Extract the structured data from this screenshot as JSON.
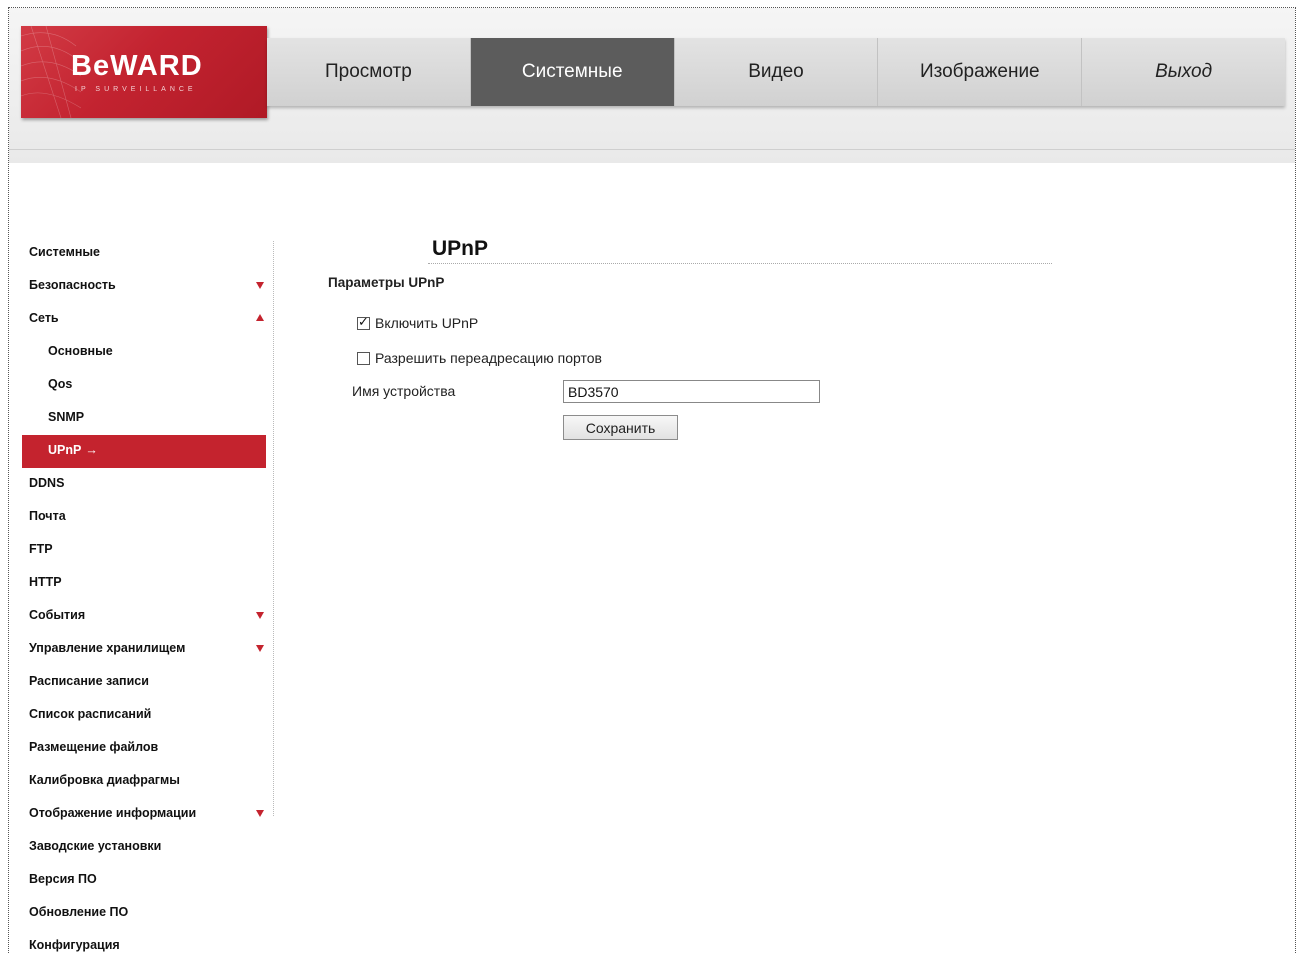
{
  "logo": {
    "brand": "BeWARD",
    "tagline": "IP SURVEILLANCE"
  },
  "nav": {
    "items": [
      {
        "label": "Просмотр"
      },
      {
        "label": "Системные"
      },
      {
        "label": "Видео"
      },
      {
        "label": "Изображение"
      },
      {
        "label": "Выход"
      }
    ],
    "active": "Системные"
  },
  "sidebar": {
    "items": [
      {
        "label": "Системные"
      },
      {
        "label": "Безопасность",
        "icon": "expand-down"
      },
      {
        "label": "Сеть",
        "icon": "collapse-up"
      },
      {
        "label": "Основные"
      },
      {
        "label": "Qos"
      },
      {
        "label": "SNMP"
      },
      {
        "label": "UPnP",
        "active_marker": "→"
      },
      {
        "label": "DDNS"
      },
      {
        "label": "Почта"
      },
      {
        "label": "FTP"
      },
      {
        "label": "HTTP"
      },
      {
        "label": "События",
        "icon": "expand-down"
      },
      {
        "label": "Управление хранилищем",
        "icon": "expand-down"
      },
      {
        "label": "Расписание записи"
      },
      {
        "label": "Список расписаний"
      },
      {
        "label": "Размещение файлов"
      },
      {
        "label": "Калибровка диафрагмы"
      },
      {
        "label": "Отображение информации",
        "icon": "expand-down"
      },
      {
        "label": "Заводские установки"
      },
      {
        "label": "Версия ПО"
      },
      {
        "label": "Обновление ПО"
      },
      {
        "label": "Конфигурация"
      }
    ],
    "active": "UPnP"
  },
  "main": {
    "title": "UPnP",
    "section_title": "Параметры UPnP",
    "enable_upnp": {
      "label": "Включить UPnP",
      "checked": true
    },
    "port_forwarding": {
      "label": "Разрешить переадресацию портов",
      "checked": false
    },
    "device_name": {
      "label": "Имя устройства",
      "value": "BD3570"
    },
    "save_label": "Сохранить"
  },
  "colors": {
    "accent": "#c4232e",
    "nav_active": "#5c5c5c",
    "header_bg": "#ececec"
  }
}
